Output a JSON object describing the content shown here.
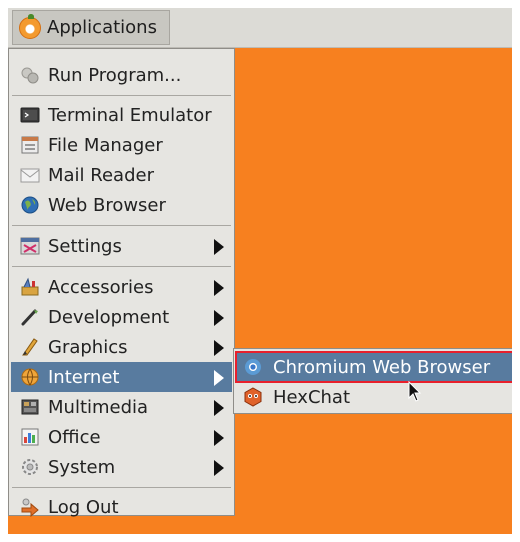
{
  "panel": {
    "applications_label": "Applications",
    "icon": "xfce-mouse-logo-icon"
  },
  "menu": {
    "items": [
      {
        "label": "Run Program...",
        "icon": "run-program-icon"
      },
      {
        "label": "Terminal Emulator",
        "icon": "terminal-icon"
      },
      {
        "label": "File Manager",
        "icon": "file-manager-icon"
      },
      {
        "label": "Mail Reader",
        "icon": "mail-icon"
      },
      {
        "label": "Web Browser",
        "icon": "globe-icon"
      },
      {
        "label": "Settings",
        "icon": "settings-icon",
        "submenu": true
      },
      {
        "label": "Accessories",
        "icon": "accessories-icon",
        "submenu": true
      },
      {
        "label": "Development",
        "icon": "development-icon",
        "submenu": true
      },
      {
        "label": "Graphics",
        "icon": "graphics-icon",
        "submenu": true
      },
      {
        "label": "Internet",
        "icon": "internet-icon",
        "submenu": true,
        "active": true
      },
      {
        "label": "Multimedia",
        "icon": "multimedia-icon",
        "submenu": true
      },
      {
        "label": "Office",
        "icon": "office-icon",
        "submenu": true
      },
      {
        "label": "System",
        "icon": "system-icon",
        "submenu": true
      },
      {
        "label": "Log Out",
        "icon": "logout-icon"
      }
    ]
  },
  "submenu": {
    "items": [
      {
        "label": "Chromium Web Browser",
        "icon": "chromium-icon",
        "highlighted": true
      },
      {
        "label": "HexChat",
        "icon": "hexchat-icon"
      }
    ]
  },
  "colors": {
    "desktop": "#f7801f",
    "selection": "#587b9f",
    "highlight_border": "#e8202c"
  }
}
